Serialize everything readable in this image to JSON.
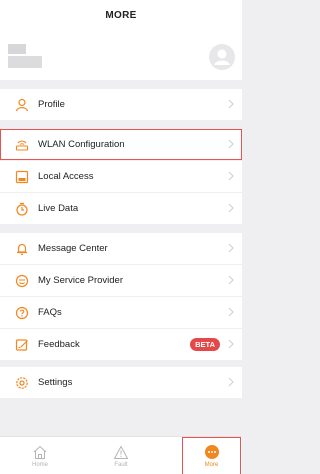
{
  "header": {
    "title": "MORE"
  },
  "menu": {
    "profile": "Profile",
    "wlan": "WLAN Configuration",
    "local_access": "Local Access",
    "live_data": "Live Data",
    "message_center": "Message Center",
    "service_provider": "My Service Provider",
    "faqs": "FAQs",
    "feedback": "Feedback",
    "feedback_badge": "BETA",
    "settings": "Settings"
  },
  "tabs": [
    {
      "label": "Home",
      "icon": "home-icon"
    },
    {
      "label": "Fault",
      "icon": "warning-icon"
    },
    {
      "label": "More",
      "icon": "more-dots-icon"
    }
  ],
  "colors": {
    "accent": "#f2861f",
    "highlight_outline": "#e8534f",
    "badge": "#e54848",
    "background": "#efeff1"
  }
}
